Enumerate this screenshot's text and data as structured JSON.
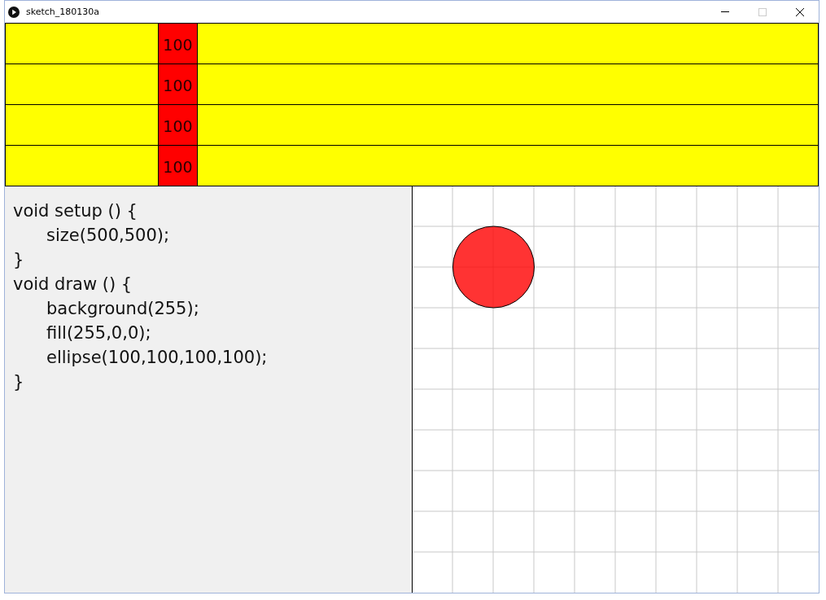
{
  "window": {
    "title": "sketch_180130a",
    "controls": [
      {
        "kind": "minimize",
        "disabled": false
      },
      {
        "kind": "maximize",
        "disabled": true
      },
      {
        "kind": "close",
        "disabled": false
      }
    ]
  },
  "table": {
    "rows": [
      {
        "column_2": "100"
      },
      {
        "column_2": "100"
      },
      {
        "column_2": "100"
      },
      {
        "column_2": "100"
      }
    ]
  },
  "code": {
    "blocks": [
      {
        "header": "void setup () {",
        "body": [
          "size(500,500);"
        ],
        "footer": "}"
      },
      {
        "header": "void draw () {",
        "body": [
          "background(255);",
          "fill(255,0,0);",
          "ellipse(100,100,100,100);"
        ],
        "footer": "}"
      }
    ]
  }
}
